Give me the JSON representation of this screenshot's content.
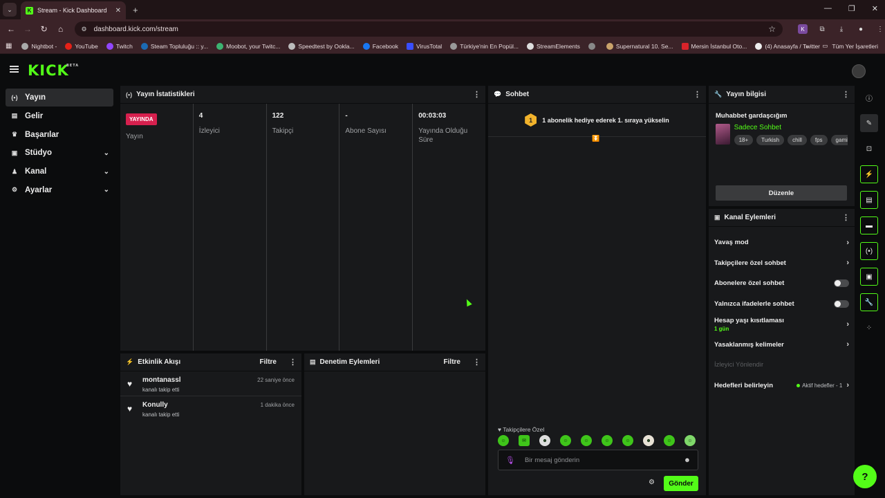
{
  "browser": {
    "tab_title": "Stream - Kick Dashboard",
    "url": "dashboard.kick.com/stream",
    "bookmarks": [
      "Nightbot -",
      "YouTube",
      "Twitch",
      "Steam Topluluğu :: y...",
      "Moobot, your Twitc...",
      "Speedtest by Ookla...",
      "Facebook",
      "VirusTotal",
      "Türkiye'nin En Popül...",
      "StreamElements",
      "",
      "Supernatural 10. Se...",
      "Mersin İstanbul Oto...",
      "(4) Anasayfa / Twitter"
    ],
    "all_bookmarks": "Tüm Yer İşaretleri"
  },
  "app": {
    "logo": "KICK",
    "logo_badge": "BETA"
  },
  "sidebar": {
    "items": [
      {
        "label": "Yayın",
        "icon": "broadcast-icon"
      },
      {
        "label": "Gelir",
        "icon": "revenue-icon"
      },
      {
        "label": "Başarılar",
        "icon": "trophy-icon"
      },
      {
        "label": "Stüdyo",
        "icon": "studio-icon"
      },
      {
        "label": "Kanal",
        "icon": "channel-icon"
      },
      {
        "label": "Ayarlar",
        "icon": "gear-icon"
      }
    ]
  },
  "stats_panel": {
    "title": "Yayın İstatistikleri",
    "live_badge": "YAYINDA",
    "stats": [
      {
        "value": "",
        "label": "Yayın"
      },
      {
        "value": "4",
        "label": "İzleyici"
      },
      {
        "value": "122",
        "label": "Takipçi"
      },
      {
        "value": "-",
        "label": "Abone Sayısı"
      },
      {
        "value": "00:03:03",
        "label": "Yayında Olduğu Süre"
      }
    ]
  },
  "chat_panel": {
    "title": "Sohbet",
    "alert_number": "1",
    "alert_text": "1 abonelik hediye ederek 1. sıraya yükselin",
    "followers_only_label": "Takipçilere Özel",
    "input_placeholder": "Bir mesaj gönderin",
    "send_label": "Gönder"
  },
  "activity_panel": {
    "title": "Etkinlik Akışı",
    "filter": "Filtre",
    "items": [
      {
        "name": "montanassl",
        "desc": "kanalı takip etti",
        "time": "22 saniye önce"
      },
      {
        "name": "Konully",
        "desc": "kanalı takip etti",
        "time": "1 dakika önce"
      }
    ]
  },
  "moderation_panel": {
    "title": "Denetim Eylemleri",
    "filter": "Filtre"
  },
  "info_panel": {
    "title": "Yayın bilgisi",
    "stream_title": "Muhabbet gardaşcığım",
    "category": "Sadece Sohbet",
    "tags": [
      "18+",
      "Turkish",
      "chill",
      "fps",
      "gamin"
    ],
    "edit_label": "Düzenle"
  },
  "actions_panel": {
    "title": "Kanal Eylemleri",
    "items": [
      {
        "label": "Yavaş mod"
      },
      {
        "label": "Takipçilere özel sohbet"
      },
      {
        "label": "Abonelere özel sohbet"
      },
      {
        "label": "Yalnızca ifadelerle sohbet"
      },
      {
        "label": "Hesap yaşı kısıtlaması",
        "sub": "1 gün"
      },
      {
        "label": "Yasaklanmış kelimeler"
      },
      {
        "label": "İzleyici Yönlendir"
      },
      {
        "label": "Hedefleri belirleyin",
        "status": "Aktif hedefler - 1"
      }
    ]
  }
}
